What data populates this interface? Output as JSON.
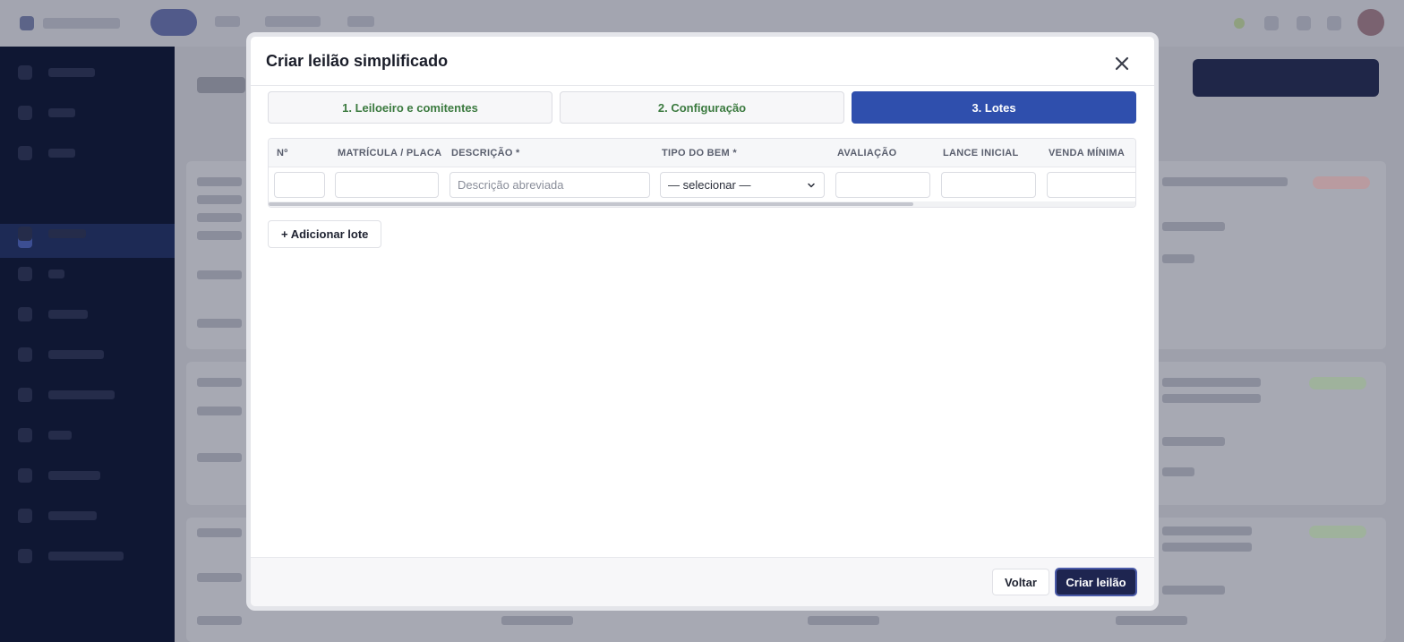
{
  "modal": {
    "title": "Criar leilão simplificado",
    "close_icon": "close-icon"
  },
  "steps": [
    {
      "label": "1. Leiloeiro e comitentes",
      "state": "complete"
    },
    {
      "label": "2. Configuração",
      "state": "complete"
    },
    {
      "label": "3. Lotes",
      "state": "active"
    }
  ],
  "lots_table": {
    "columns": [
      "Nº",
      "MATRÍCULA / PLACA",
      "DESCRIÇÃO *",
      "TIPO DO BEM *",
      "AVALIAÇÃO",
      "LANCE INICIAL",
      "VENDA MÍNIMA"
    ],
    "row": {
      "numero": "",
      "matricula": "",
      "descricao": "",
      "descricao_placeholder": "Descrição abreviada",
      "tipo_bem": "— selecionar —",
      "avaliacao": "",
      "lance_inicial": "",
      "venda_minima": ""
    }
  },
  "add_lot_label": "+ Adicionar lote",
  "footer": {
    "back_label": "Voltar",
    "create_label": "Criar leilão"
  },
  "colors": {
    "primary": "#2f4fad",
    "primary_dark": "#1e2550",
    "step_done_text": "#3b7a3f",
    "sidebar_bg": "#0f1733"
  }
}
